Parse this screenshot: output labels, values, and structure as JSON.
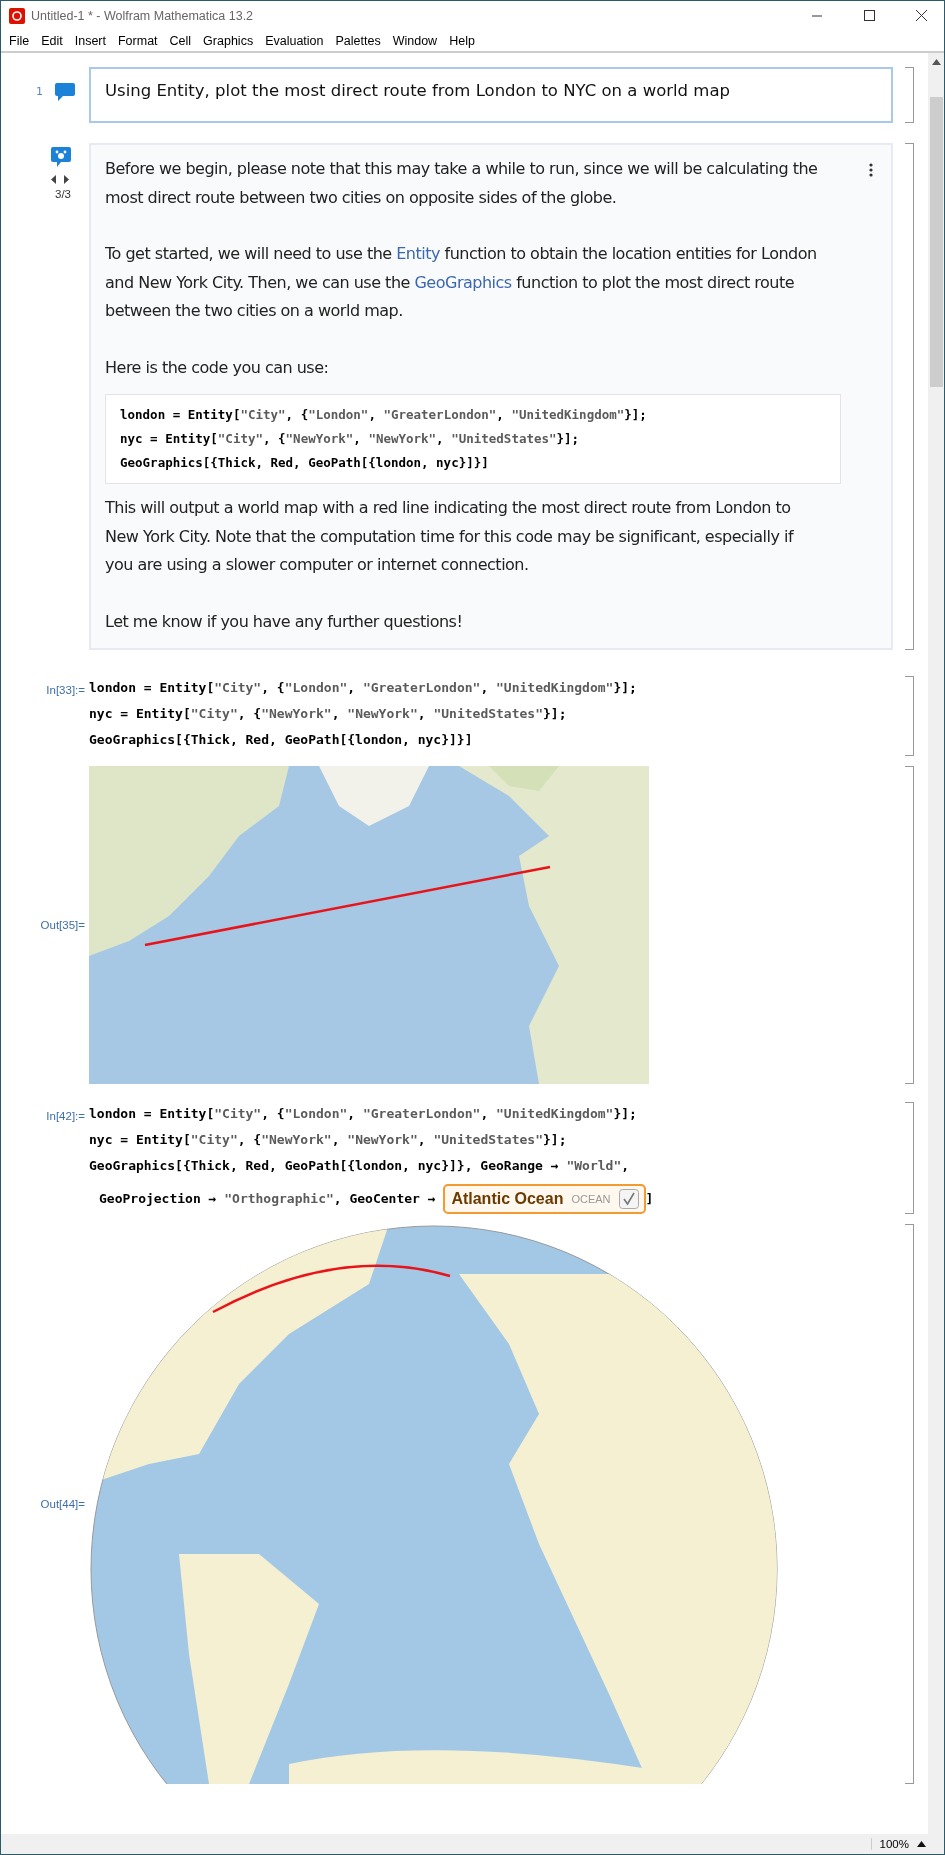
{
  "window": {
    "title": "Untitled-1 * - Wolfram Mathematica 13.2"
  },
  "menu": [
    "File",
    "Edit",
    "Insert",
    "Format",
    "Cell",
    "Graphics",
    "Evaluation",
    "Palettes",
    "Window",
    "Help"
  ],
  "cells": [
    {
      "kind": "prompt",
      "number": "1",
      "text": "Using Entity, plot the most direct route from London to NYC on a world map"
    },
    {
      "kind": "response",
      "pager": "3/3",
      "blocks": [
        {
          "kind": "para",
          "segments": [
            {
              "text": "Before we begin, please note that this may take a while to run, since we will be calculating the most direct route between two cities on opposite sides of the globe.",
              "link": false
            }
          ]
        },
        {
          "kind": "para",
          "segments": [
            {
              "text": "To get started, we will need to use the ",
              "link": false
            },
            {
              "text": "Entity",
              "link": true
            },
            {
              "text": " function to obtain the location entities for London and New York City. Then, we can use the ",
              "link": false
            },
            {
              "text": "GeoGraphics",
              "link": true
            },
            {
              "text": " function to plot the most direct route between the two cities on a world map.",
              "link": false
            }
          ]
        },
        {
          "kind": "para",
          "segments": [
            {
              "text": "Here is the code you can use:",
              "link": false
            }
          ]
        },
        {
          "kind": "code",
          "lines": [
            "london = Entity[\"City\", {\"London\", \"GreaterLondon\", \"UnitedKingdom\"}];",
            "nyc = Entity[\"City\", {\"NewYork\", \"NewYork\", \"UnitedStates\"}];",
            "GeoGraphics[{Thick, Red, GeoPath[{london, nyc}]}]"
          ]
        },
        {
          "kind": "para",
          "segments": [
            {
              "text": "This will output a world map with a red line indicating the most direct route from London to New York City. Note that the computation time for this code may be significant, especially if you are using a slower computer or internet connection.",
              "link": false
            }
          ]
        },
        {
          "kind": "para",
          "segments": [
            {
              "text": "Let me know if you have any further questions!",
              "link": false
            }
          ]
        }
      ]
    },
    {
      "kind": "input",
      "label": "In[33]:=",
      "lines": [
        "london = Entity[\"City\", {\"London\", \"GreaterLondon\", \"UnitedKingdom\"}];",
        "nyc = Entity[\"City\", {\"NewYork\", \"NewYork\", \"UnitedStates\"}];",
        "GeoGraphics[{Thick, Red, GeoPath[{london, nyc}]}]"
      ]
    },
    {
      "kind": "flat_map",
      "label": "Out[35]="
    },
    {
      "kind": "input",
      "label": "In[42]:=",
      "lines": [
        "london = Entity[\"City\", {\"London\", \"GreaterLondon\", \"UnitedKingdom\"}];",
        "nyc = Entity[\"City\", {\"NewYork\", \"NewYork\", \"UnitedStates\"}];",
        "GeoGraphics[{Thick, Red, GeoPath[{london, nyc}]}, GeoRange → \"World\","
      ],
      "last_line": {
        "prefix": "GeoProjection → \"Orthographic\", GeoCenter → ",
        "entity": {
          "name": "Atlantic Ocean",
          "type": "OCEAN"
        },
        "suffix": "]"
      }
    },
    {
      "kind": "globe_map",
      "label": "Out[44]="
    }
  ],
  "status_bar": {
    "zoom": "100%"
  }
}
